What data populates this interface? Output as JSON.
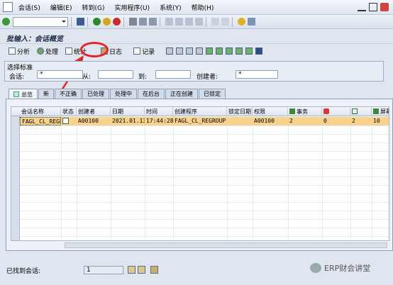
{
  "menubar": {
    "items": [
      "会话(S)",
      "编辑(E)",
      "转到(G)",
      "实用程序(U)",
      "系统(Y)",
      "帮助(H)"
    ]
  },
  "page_title": "批输入：会话概览",
  "app_toolbar": {
    "buttons": [
      "分析",
      "处理",
      "统计",
      "日志",
      "记录"
    ]
  },
  "selection": {
    "header": "选择标准",
    "session_label": "会话:",
    "session_value": "*",
    "from_label": "从:",
    "from_value": "",
    "to_label": "到:",
    "to_value": "",
    "creator_label": "创建者:",
    "creator_value": "*"
  },
  "tabs": [
    "总览",
    "新",
    "不正确",
    "已处理",
    "处理中",
    "在后台",
    "正在创建",
    "已锁定"
  ],
  "grid": {
    "headers": [
      "会话名称",
      "状态",
      "创建者",
      "日期",
      "时间",
      "创建程序",
      "锁定日期",
      "权限",
      "事务",
      "",
      "",
      "屏幕"
    ],
    "rows": [
      {
        "name": "FAGL_CL_REGR",
        "creator": "A00100",
        "date": "2021.01.13",
        "time": "17:44:28",
        "program": "FAGL_CL_REGROUP",
        "lock_date": "",
        "auth": "A00100",
        "trans": "2",
        "err": "0",
        "done": "2",
        "screens": "10"
      }
    ]
  },
  "status": {
    "label": "已找到会话:",
    "count": "1"
  },
  "watermark": "ERP财会讲堂",
  "colors": {
    "highlight_row": "#f7d38e",
    "annotation": "#e52525"
  }
}
